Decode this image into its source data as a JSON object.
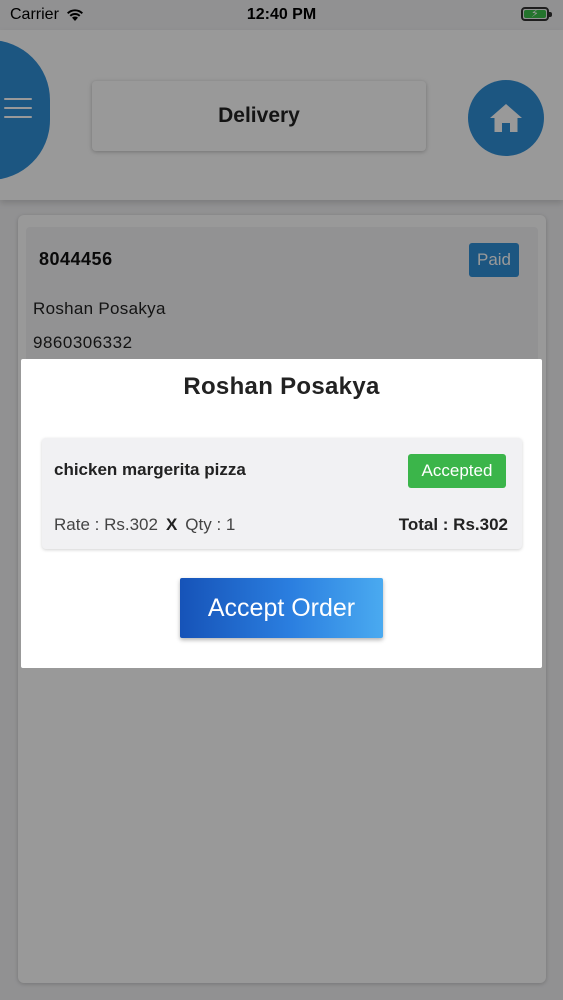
{
  "status_bar": {
    "carrier": "Carrier",
    "time": "12:40 PM",
    "wifi_icon": "wifi-icon",
    "battery_icon": "battery-charging-icon"
  },
  "header": {
    "menu_icon": "hamburger-menu-icon",
    "title": "Delivery",
    "home_icon": "home-icon",
    "accent_color": "#2f8fd8"
  },
  "order_card": {
    "order_id": "8044456",
    "payment_status": "Paid",
    "customer_name": "Roshan Posakya",
    "customer_phone": "9860306332"
  },
  "modal": {
    "title": "Roshan Posakya",
    "items": [
      {
        "name": "chicken margerita pizza",
        "status": "Accepted",
        "status_color": "#3bb54a",
        "rate_label": "Rate : Rs.302",
        "times": "X",
        "qty_label": "Qty : 1",
        "total_label": "Total : Rs.302"
      }
    ],
    "accept_button_label": "Accept Order"
  }
}
